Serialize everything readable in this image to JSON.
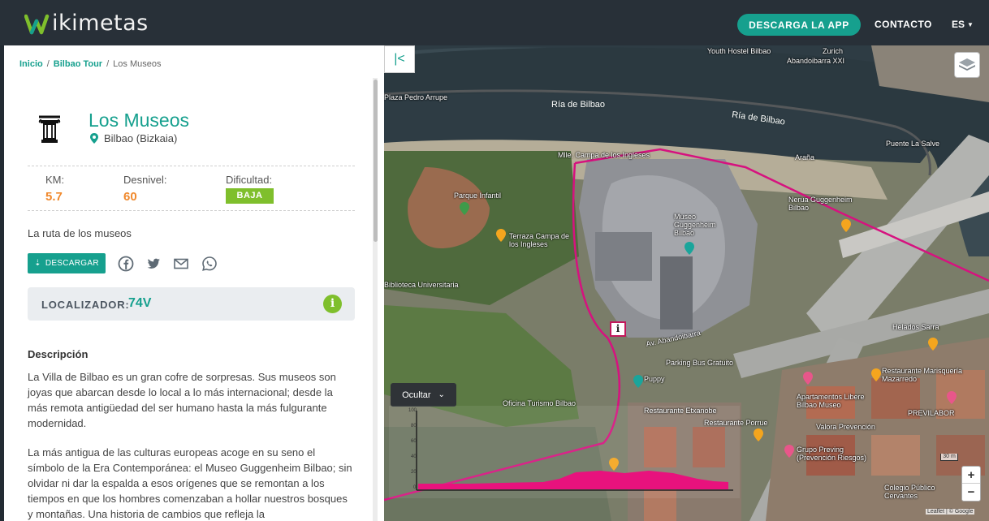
{
  "header": {
    "logo_text": "ikimetas",
    "download_app": "DESCARGA LA APP",
    "contact": "CONTACTO",
    "lang": "ES",
    "brand_color": "#16a08e"
  },
  "breadcrumb": {
    "home": "Inicio",
    "sep1": "/",
    "tour": "Bilbao Tour",
    "sep2": "/",
    "current": "Los Museos"
  },
  "poi": {
    "title": "Los Museos",
    "location": "Bilbao (Bizkaia)",
    "icon": "museum-column-icon"
  },
  "stats": {
    "km_label": "KM:",
    "km_value": "5.7",
    "desnivel_label": "Desnivel:",
    "desnivel_value": "60",
    "dificultad_label": "Dificultad:",
    "dificultad_value": "BAJA"
  },
  "subtitle": "La ruta de los museos",
  "actions": {
    "download": "DESCARGAR",
    "share_icons": [
      "facebook-icon",
      "twitter-icon",
      "email-icon",
      "whatsapp-icon"
    ]
  },
  "locator": {
    "label": "LOCALIZADOR:",
    "value": "74V",
    "info": "i"
  },
  "description": {
    "heading": "Descripción",
    "p1": "La Villa de Bilbao es un gran cofre de sorpresas. Sus museos son joyas que abarcan desde lo local a lo más internacional; desde la más remota antigüedad del ser humano hasta la más fulgurante modernidad.",
    "p2": "La más antigua de las culturas europeas acoge en su seno el símbolo de la Era Contemporánea: el Museo Guggenheim Bilbao; sin olvidar ni dar la espalda a esos orígenes que se remontan a los tiempos en que los hombres comenzaban a hollar nuestros bosques y montañas. Una historia de cambios que refleja la"
  },
  "map": {
    "collapse": "|<",
    "ocultar": "Ocultar",
    "zoom_in": "+",
    "zoom_out": "−",
    "scale": "30 m",
    "attribution": "Leaflet | © Google",
    "info_marker": "i",
    "profile_ticks": [
      "100",
      "80",
      "60",
      "40",
      "20",
      "0"
    ],
    "labels": [
      {
        "text": "Ría de Bilbao",
        "cls": "river"
      },
      {
        "text": "Ría de Bilbao",
        "cls": "river"
      },
      {
        "text": "Museo Guggenheim Bilbao",
        "cls": ""
      },
      {
        "text": "Parque Infantil",
        "cls": ""
      },
      {
        "text": "Terraza Campa de los Ingleses",
        "cls": ""
      },
      {
        "text": "Mlle. Campa de los Ingleses",
        "cls": ""
      },
      {
        "text": "Araña",
        "cls": ""
      },
      {
        "text": "Puente La Salve",
        "cls": ""
      },
      {
        "text": "Nerua Guggenheim Bilbao",
        "cls": ""
      },
      {
        "text": "Av. Abandoibarra",
        "cls": ""
      },
      {
        "text": "Parking Bus Gratuito",
        "cls": ""
      },
      {
        "text": "Puppy",
        "cls": ""
      },
      {
        "text": "Oficina Turismo Bilbao",
        "cls": ""
      },
      {
        "text": "Restaurante Marisquería Mazarredo",
        "cls": ""
      },
      {
        "text": "Apartamentos Libere Bilbao Museo",
        "cls": ""
      },
      {
        "text": "Valora Prevención",
        "cls": ""
      },
      {
        "text": "Restaurante Porrue",
        "cls": ""
      },
      {
        "text": "Colegio Público Cervantes",
        "cls": ""
      },
      {
        "text": "Grupo Preving (Prevención Riesgos)",
        "cls": ""
      },
      {
        "text": "Helados Sarra",
        "cls": ""
      },
      {
        "text": "Biblioteca Universitaria",
        "cls": ""
      },
      {
        "text": "Zurich",
        "cls": ""
      },
      {
        "text": "Abandoibarra XXI",
        "cls": ""
      },
      {
        "text": "Youth Hostel Bilbao",
        "cls": ""
      },
      {
        "text": "Plaza Pedro Arrupe",
        "cls": ""
      },
      {
        "text": "Restaurante Etxanobe",
        "cls": ""
      },
      {
        "text": "PREVILABOR",
        "cls": ""
      }
    ]
  }
}
